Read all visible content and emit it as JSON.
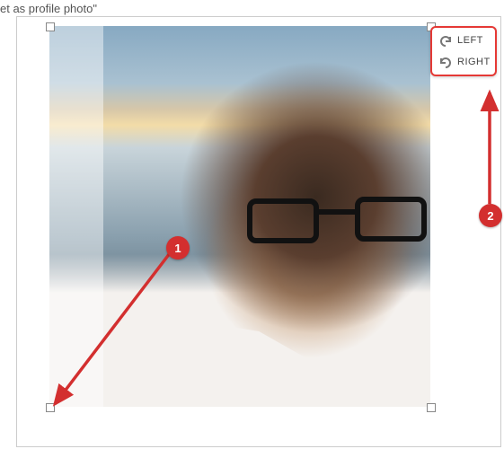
{
  "header": {
    "title_fragment": "et as profile photo\""
  },
  "rotate": {
    "left_label": "LEFT",
    "right_label": "RIGHT"
  },
  "annotations": {
    "badge1": "1",
    "badge2": "2"
  }
}
